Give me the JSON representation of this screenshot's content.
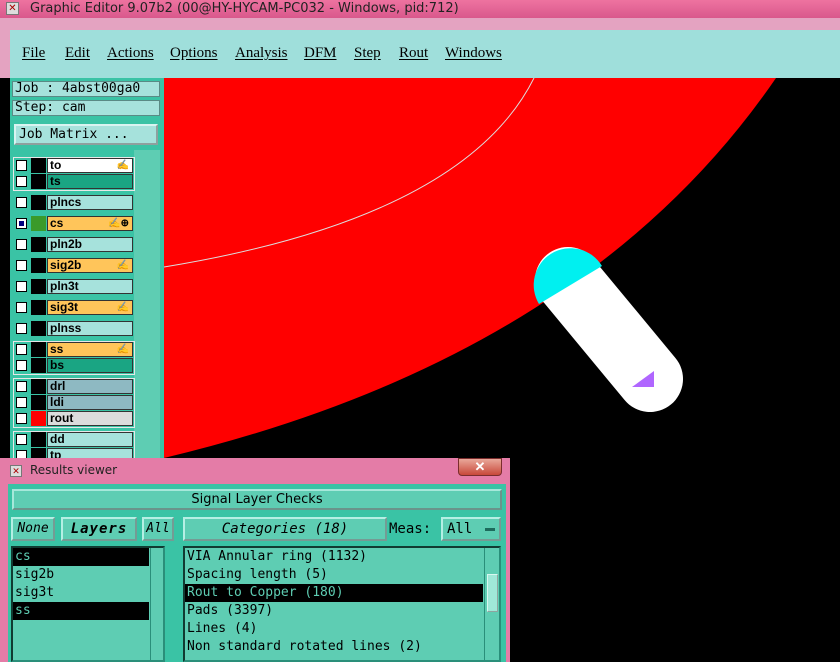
{
  "window": {
    "title": "Graphic Editor 9.07b2 (00@HY-HYCAM-PC032 - Windows, pid:712)"
  },
  "menu": [
    "File",
    "Edit",
    "Actions",
    "Options",
    "Analysis",
    "DFM",
    "Step",
    "Rout",
    "Windows"
  ],
  "job": {
    "job_label": "Job : 4abst00ga0",
    "step_label": "Step: cam",
    "matrix_button": "Job Matrix ..."
  },
  "layers": [
    {
      "name": "to",
      "color": "#ffffff",
      "checked": false,
      "flag": "✍"
    },
    {
      "name": "ts",
      "color": "#1aa583",
      "checked": false,
      "flag": ""
    },
    {
      "name": "plncs",
      "color": "#a6e2dc",
      "checked": false,
      "flag": ""
    },
    {
      "name": "cs",
      "color": "#ffc55a",
      "checked": true,
      "flag": "✍⊕"
    },
    {
      "name": "pln2b",
      "color": "#a6e2dc",
      "checked": false,
      "flag": ""
    },
    {
      "name": "sig2b",
      "color": "#ffc55a",
      "checked": false,
      "flag": "✍"
    },
    {
      "name": "pln3t",
      "color": "#a6e2dc",
      "checked": false,
      "flag": ""
    },
    {
      "name": "sig3t",
      "color": "#ffc55a",
      "checked": false,
      "flag": "✍"
    },
    {
      "name": "plnss",
      "color": "#a6e2dc",
      "checked": false,
      "flag": ""
    },
    {
      "name": "ss",
      "color": "#ffc55a",
      "checked": false,
      "flag": "✍"
    },
    {
      "name": "bs",
      "color": "#1aa583",
      "checked": false,
      "flag": ""
    },
    {
      "name": "drl",
      "color": "#8eb9c2",
      "checked": false,
      "flag": ""
    },
    {
      "name": "ldi",
      "color": "#8eb9c2",
      "checked": false,
      "flag": ""
    },
    {
      "name": "rout",
      "color": "#dcdcdc",
      "checked": false,
      "flag": ""
    },
    {
      "name": "dd",
      "color": "#a6e2dc",
      "checked": false,
      "flag": ""
    },
    {
      "name": "tp",
      "color": "#a6e2dc",
      "checked": false,
      "flag": ""
    }
  ],
  "results": {
    "window_title": "Results viewer",
    "close": "✕",
    "heading": "Signal Layer Checks",
    "none_btn": "None",
    "layers_btn": "Layers",
    "all_btn": "All",
    "categories_btn": "Categories (18)",
    "meas_label": "Meas:",
    "meas_value": "All",
    "layer_list": [
      {
        "name": "cs",
        "selected": true
      },
      {
        "name": "sig2b",
        "selected": false
      },
      {
        "name": "sig3t",
        "selected": false
      },
      {
        "name": "ss",
        "selected": true
      }
    ],
    "categories": [
      {
        "name": "VIA Annular ring (1132)",
        "selected": false
      },
      {
        "name": "Spacing length (5)",
        "selected": false
      },
      {
        "name": "Rout to Copper (180)",
        "selected": true
      },
      {
        "name": "Pads (3397)",
        "selected": false
      },
      {
        "name": "Lines (4)",
        "selected": false
      },
      {
        "name": "Non standard rotated lines (2)",
        "selected": false
      }
    ]
  }
}
